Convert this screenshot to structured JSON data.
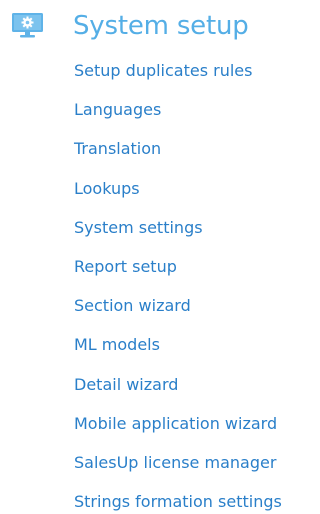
{
  "section": {
    "icon": "monitor-gear-icon",
    "title": "System setup",
    "links": [
      {
        "label": "Setup duplicates rules"
      },
      {
        "label": "Languages"
      },
      {
        "label": "Translation"
      },
      {
        "label": "Lookups"
      },
      {
        "label": "System settings"
      },
      {
        "label": "Report setup"
      },
      {
        "label": "Section wizard"
      },
      {
        "label": "ML models"
      },
      {
        "label": "Detail wizard"
      },
      {
        "label": "Mobile application wizard"
      },
      {
        "label": "SalesUp license manager"
      },
      {
        "label": "Strings formation settings"
      }
    ]
  },
  "colors": {
    "title": "#54aee6",
    "link": "#2a7fc9",
    "icon": "#5fb3e8",
    "background": "#ffffff"
  }
}
